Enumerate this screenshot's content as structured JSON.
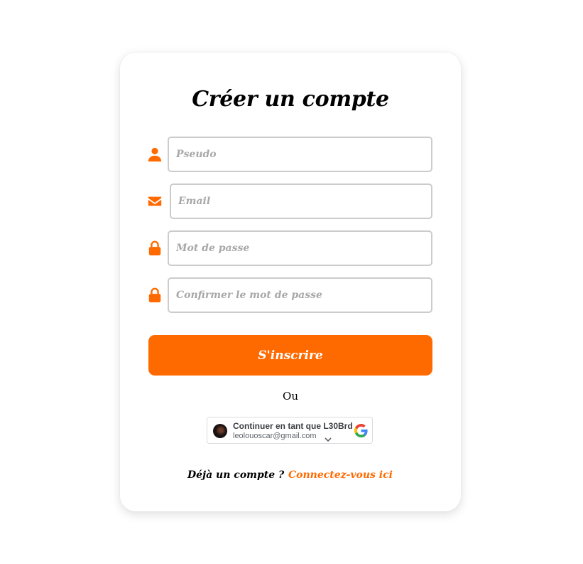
{
  "form": {
    "title": "Créer un compte",
    "fields": [
      {
        "placeholder": "Pseudo",
        "icon": "user-icon",
        "value": ""
      },
      {
        "placeholder": "Email",
        "icon": "envelope-icon",
        "value": ""
      },
      {
        "placeholder": "Mot de passe",
        "icon": "lock-icon",
        "value": ""
      },
      {
        "placeholder": "Confirmer le mot de passe",
        "icon": "lock-icon",
        "value": ""
      }
    ],
    "submit_label": "S'inscrire",
    "or_label": "Ou"
  },
  "google": {
    "continue_label": "Continuer en tant que L30Brd",
    "email": "leolouoscar@gmail.com",
    "icon": "google-logo-icon"
  },
  "footer": {
    "text": "Déjà un compte ?",
    "link_label": "Connectez-vous ici"
  },
  "colors": {
    "accent": "#ff6a00",
    "input_border": "#cccccc",
    "placeholder": "#a8a8a8",
    "background": "#ffffff"
  }
}
